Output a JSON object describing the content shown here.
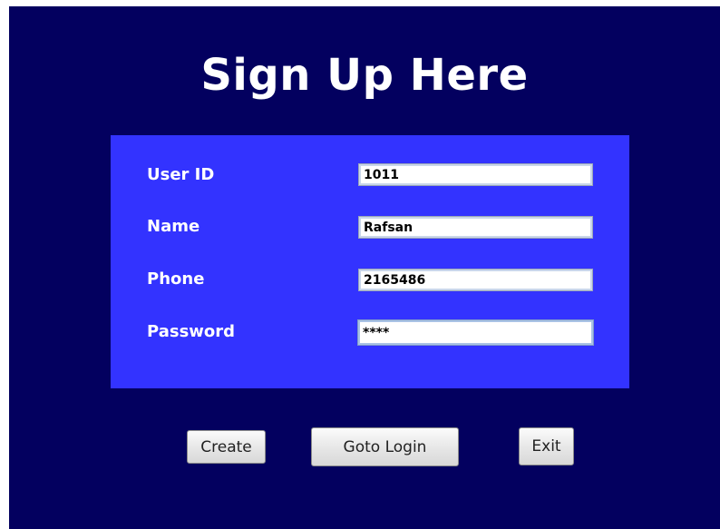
{
  "header": {
    "title": "Sign Up Here"
  },
  "form": {
    "fields": [
      {
        "label": "User ID",
        "value": "1011"
      },
      {
        "label": "Name",
        "value": "Rafsan"
      },
      {
        "label": "Phone",
        "value": "2165486"
      },
      {
        "label": "Password",
        "value": "****"
      }
    ]
  },
  "buttons": {
    "create": "Create",
    "goto_login": "Goto Login",
    "exit": "Exit"
  },
  "colors": {
    "window_background": "#03005f",
    "panel_background": "#3333ff",
    "text": "#ffffff"
  }
}
